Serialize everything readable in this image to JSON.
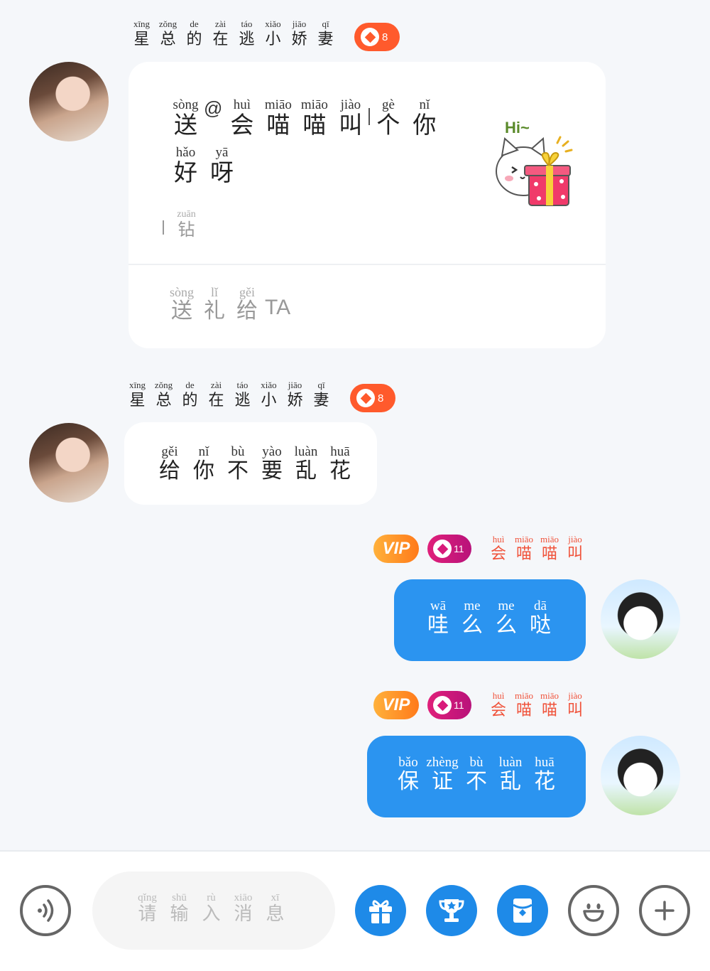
{
  "message1": {
    "sender_name": [
      {
        "py": "xīng",
        "hz": "星"
      },
      {
        "py": "zǒng",
        "hz": "总"
      },
      {
        "py": "de",
        "hz": "的"
      },
      {
        "py": "zài",
        "hz": "在"
      },
      {
        "py": "táo",
        "hz": "逃"
      },
      {
        "py": "xiǎo",
        "hz": "小"
      },
      {
        "py": "jiāo",
        "hz": "娇"
      },
      {
        "py": "qī",
        "hz": "妻"
      }
    ],
    "level": "8",
    "gift_line1": [
      {
        "py": "sòng",
        "hz": "送"
      },
      {
        "py": "huì",
        "hz": "会"
      },
      {
        "py": "miāo",
        "hz": "喵"
      },
      {
        "py": "miāo",
        "hz": "喵"
      },
      {
        "py": "jiào",
        "hz": "叫"
      },
      {
        "py": "gè",
        "hz": "个"
      },
      {
        "py": "nǐ",
        "hz": "你"
      }
    ],
    "at_sign": "@",
    "gift_line2": [
      {
        "py": "hǎo",
        "hz": "好"
      },
      {
        "py": "yā",
        "hz": "呀"
      }
    ],
    "diamond": {
      "py": "zuān",
      "hz": "钻"
    },
    "send_gift": [
      {
        "py": "sòng",
        "hz": "送"
      },
      {
        "py": "lǐ",
        "hz": "礼"
      },
      {
        "py": "gěi",
        "hz": "给"
      }
    ],
    "send_gift_target": "TA",
    "sticker_text": "Hi~"
  },
  "message2": {
    "sender_name": [
      {
        "py": "xīng",
        "hz": "星"
      },
      {
        "py": "zǒng",
        "hz": "总"
      },
      {
        "py": "de",
        "hz": "的"
      },
      {
        "py": "zài",
        "hz": "在"
      },
      {
        "py": "táo",
        "hz": "逃"
      },
      {
        "py": "xiǎo",
        "hz": "小"
      },
      {
        "py": "jiāo",
        "hz": "娇"
      },
      {
        "py": "qī",
        "hz": "妻"
      }
    ],
    "level": "8",
    "text": [
      {
        "py": "gěi",
        "hz": "给"
      },
      {
        "py": "nǐ",
        "hz": "你"
      },
      {
        "py": "bù",
        "hz": "不"
      },
      {
        "py": "yào",
        "hz": "要"
      },
      {
        "py": "luàn",
        "hz": "乱"
      },
      {
        "py": "huā",
        "hz": "花"
      }
    ]
  },
  "message3": {
    "vip": "VIP",
    "level": "11",
    "sender_name": [
      {
        "py": "huì",
        "hz": "会"
      },
      {
        "py": "miāo",
        "hz": "喵"
      },
      {
        "py": "miāo",
        "hz": "喵"
      },
      {
        "py": "jiào",
        "hz": "叫"
      }
    ],
    "text": [
      {
        "py": "wā",
        "hz": "哇"
      },
      {
        "py": "me",
        "hz": "么"
      },
      {
        "py": "me",
        "hz": "么"
      },
      {
        "py": "dā",
        "hz": "哒"
      }
    ]
  },
  "message4": {
    "vip": "VIP",
    "level": "11",
    "sender_name": [
      {
        "py": "huì",
        "hz": "会"
      },
      {
        "py": "miāo",
        "hz": "喵"
      },
      {
        "py": "miāo",
        "hz": "喵"
      },
      {
        "py": "jiào",
        "hz": "叫"
      }
    ],
    "text": [
      {
        "py": "bǎo",
        "hz": "保"
      },
      {
        "py": "zhèng",
        "hz": "证"
      },
      {
        "py": "bù",
        "hz": "不"
      },
      {
        "py": "luàn",
        "hz": "乱"
      },
      {
        "py": "huā",
        "hz": "花"
      }
    ]
  },
  "input": {
    "placeholder": [
      {
        "py": "qǐng",
        "hz": "请"
      },
      {
        "py": "shū",
        "hz": "输"
      },
      {
        "py": "rù",
        "hz": "入"
      },
      {
        "py": "xiāo",
        "hz": "消"
      },
      {
        "py": "xī",
        "hz": "息"
      }
    ]
  },
  "toolbar_icons": [
    "voice-icon",
    "gift-icon",
    "trophy-icon",
    "red-packet-icon",
    "emoji-icon",
    "plus-icon"
  ],
  "colors": {
    "background": "#f5f7fa",
    "bubble_blue": "#2b94f0",
    "level_orange": "#ff5a2c",
    "level_pink": "#d81b7a",
    "vip_orange": "#ff9a2a",
    "name_red": "#f0533b",
    "toolbar_blue": "#1e8ae8"
  }
}
